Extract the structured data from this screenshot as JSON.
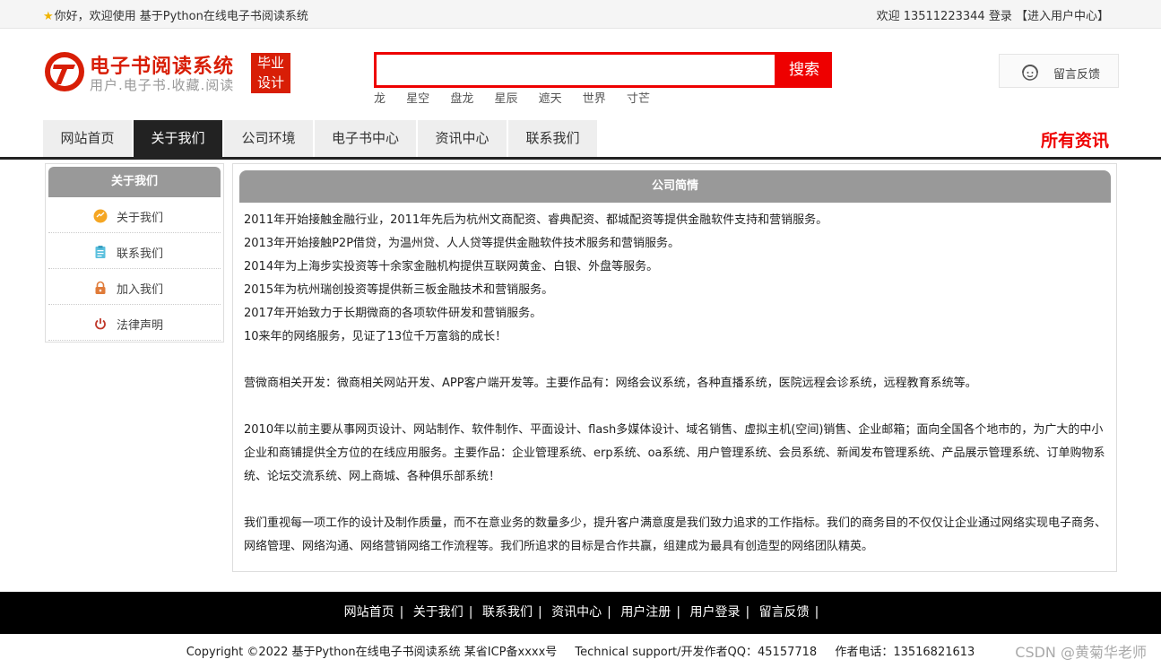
{
  "topbar": {
    "greeting": "你好，欢迎使用 基于Python在线电子书阅读系统",
    "welcome": "欢迎 13511223344",
    "login": "登录",
    "user_center": "【进入用户中心】"
  },
  "logo": {
    "title": "电子书阅读系统",
    "subtitle": "用户.电子书.收藏.阅读",
    "badge_line1": "毕业",
    "badge_line2": "设计"
  },
  "search": {
    "value": "",
    "button": "搜索",
    "hot_words": [
      "龙",
      "星空",
      "盘龙",
      "星辰",
      "遮天",
      "世界",
      "寸芒"
    ]
  },
  "feedback": {
    "label": "留言反馈"
  },
  "nav": {
    "items": [
      "网站首页",
      "关于我们",
      "公司环境",
      "电子书中心",
      "资讯中心",
      "联系我们"
    ],
    "active_index": 1,
    "all_news": "所有资讯"
  },
  "sidebar": {
    "title": "关于我们",
    "items": [
      {
        "label": "关于我们",
        "icon": "orange-circle-icon"
      },
      {
        "label": "联系我们",
        "icon": "clipboard-icon"
      },
      {
        "label": "加入我们",
        "icon": "lock-icon"
      },
      {
        "label": "法律声明",
        "icon": "power-icon"
      }
    ]
  },
  "main": {
    "title": "公司简情",
    "paragraphs": [
      "2011年开始接触金融行业，2011年先后为杭州文商配资、睿典配资、都城配资等提供金融软件支持和营销服务。",
      "2013年开始接触P2P借贷，为温州贷、人人贷等提供金融软件技术服务和营销服务。",
      "2014年为上海步实投资等十余家金融机构提供互联网黄金、白银、外盘等服务。",
      "2015年为杭州瑞创投资等提供新三板金融技术和营销服务。",
      "2017年开始致力于长期微商的各项软件研发和营销服务。",
      "10来年的网络服务，见证了13位千万富翁的成长！",
      "",
      "营微商相关开发：微商相关网站开发、APP客户端开发等。主要作品有：网络会议系统，各种直播系统，医院远程会诊系统，远程教育系统等。",
      "",
      "2010年以前主要从事网页设计、网站制作、软件制作、平面设计、flash多媒体设计、域名销售、虚拟主机(空间)销售、企业邮箱；面向全国各个地市的，为广大的中小企业和商铺提供全方位的在线应用服务。主要作品：企业管理系统、erp系统、oa系统、用户管理系统、会员系统、新闻发布管理系统、产品展示管理系统、订单购物系统、论坛交流系统、网上商城、各种俱乐部系统！",
      "",
      "我们重视每一项工作的设计及制作质量，而不在意业务的数量多少，提升客户满意度是我们致力追求的工作指标。我们的商务目的不仅仅让企业通过网络实现电子商务、网络管理、网络沟通、网络营销网络工作流程等。我们所追求的目标是合作共赢，组建成为最具有创造型的网络团队精英。"
    ]
  },
  "footer": {
    "links": [
      "网站首页",
      "关于我们",
      "联系我们",
      "资讯中心",
      "用户注册",
      "用户登录",
      "留言反馈"
    ],
    "copyright": "Copyright ©2022 基于Python在线电子书阅读系统 某省ICP备xxxx号",
    "support": "Technical support/开发作者QQ：45157718",
    "phone": "作者电话：13516821613",
    "watermark": "CSDN @黄菊华老师"
  },
  "colors": {
    "accent": "#dd0000",
    "nav_active": "#222222",
    "panel_head": "#999999"
  }
}
